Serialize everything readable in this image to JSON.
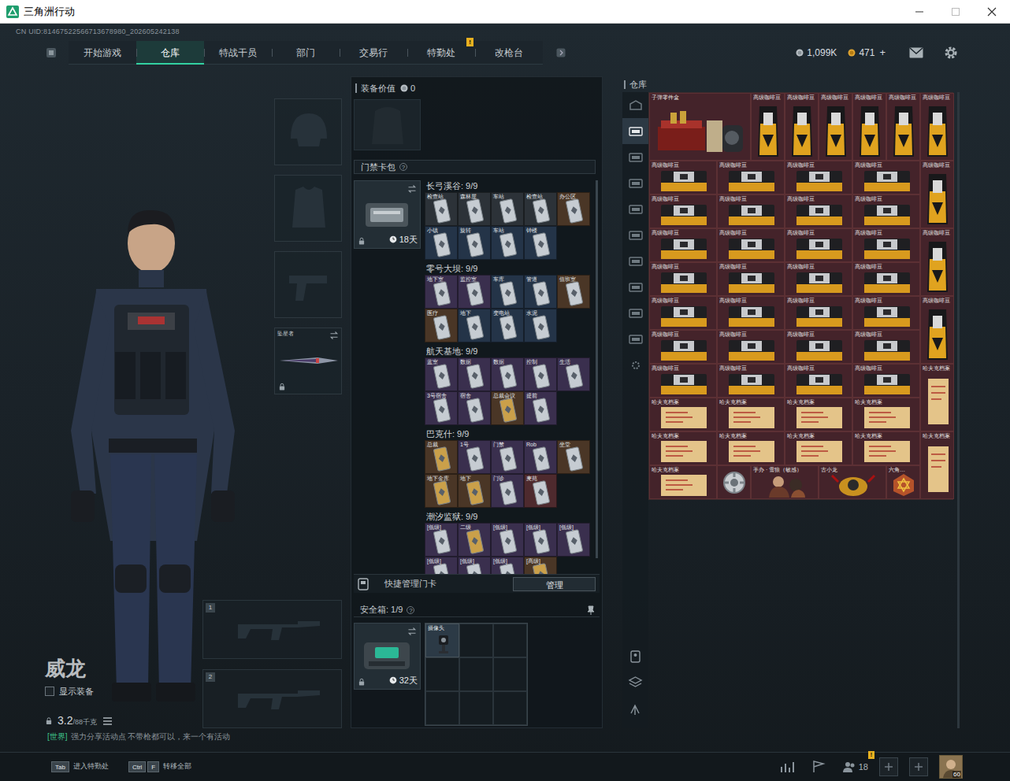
{
  "window": {
    "title": "三角洲行动"
  },
  "uid": "CN UID:81467522566713678980_202605242138",
  "nav": {
    "tabs": [
      {
        "label": "开始游戏",
        "selected": false
      },
      {
        "label": "仓库",
        "selected": true
      },
      {
        "label": "特战干员",
        "selected": false
      },
      {
        "label": "部门",
        "selected": false
      },
      {
        "label": "交易行",
        "selected": false
      },
      {
        "label": "特勤处",
        "selected": false,
        "badge": "!"
      },
      {
        "label": "改枪台",
        "selected": false
      }
    ]
  },
  "currency": {
    "coins": "1,099K",
    "premium": "471",
    "add": "+"
  },
  "operator": {
    "name": "威龙",
    "show_gear": {
      "label": "显示装备",
      "checked": false
    },
    "weight": "3.2",
    "weight_max": "/88千克"
  },
  "chat": {
    "channel": "[世界]",
    "text": "强力分享活动点 不带枪都可以，来一个有活动"
  },
  "gear_slots": [
    {
      "kind": "helmet"
    },
    {
      "kind": "armor"
    },
    {
      "kind": "pistol"
    },
    {
      "kind": "melee",
      "label": "坠星者",
      "locked": true
    }
  ],
  "weapon_slots": [
    {
      "number": "1"
    },
    {
      "number": "2"
    }
  ],
  "loadout": {
    "value_label": "装备价值",
    "value": "0",
    "keycard": {
      "title": "门禁卡包",
      "help": "?",
      "days": "18天",
      "maps": [
        {
          "title": "长弓溪谷: 9/9",
          "cards": [
            {
              "label": "检查站",
              "color": "#2c3238",
              "kind": "silver"
            },
            {
              "label": "森林屋",
              "color": "#2c3238",
              "kind": "silver"
            },
            {
              "label": "车站",
              "color": "#2c3238",
              "kind": "silver"
            },
            {
              "label": "检查站",
              "color": "#2c3238",
              "kind": "silver"
            },
            {
              "label": "办公区",
              "color": "#4a3626",
              "kind": "silver"
            },
            {
              "label": "小镇",
              "color": "#243448",
              "kind": "silver"
            },
            {
              "label": "旋转",
              "color": "#243448",
              "kind": "silver"
            },
            {
              "label": "车站",
              "color": "#243448",
              "kind": "silver"
            },
            {
              "label": "钟楼",
              "color": "#243448",
              "kind": "silver"
            }
          ]
        },
        {
          "title": "零号大坝: 9/9",
          "cards": [
            {
              "label": "地下室",
              "color": "#3a2f4e",
              "kind": "silver"
            },
            {
              "label": "监控室",
              "color": "#3a2f4e",
              "kind": "silver"
            },
            {
              "label": "车库",
              "color": "#243448",
              "kind": "silver"
            },
            {
              "label": "管道",
              "color": "#243448",
              "kind": "silver"
            },
            {
              "label": "值班室",
              "color": "#4a3626",
              "kind": "silver"
            },
            {
              "label": "医疗",
              "color": "#4a3626",
              "kind": "silver"
            },
            {
              "label": "地下",
              "color": "#243448",
              "kind": "silver"
            },
            {
              "label": "变电站",
              "color": "#243448",
              "kind": "silver"
            },
            {
              "label": "水泥",
              "color": "#243448",
              "kind": "silver"
            }
          ]
        },
        {
          "title": "航天基地: 9/9",
          "cards": [
            {
              "label": "蓝室",
              "color": "#3a2f4e",
              "kind": "silver"
            },
            {
              "label": "数据",
              "color": "#3a2f4e",
              "kind": "silver"
            },
            {
              "label": "数据",
              "color": "#3a2f4e",
              "kind": "silver"
            },
            {
              "label": "控制",
              "color": "#3a2f4e",
              "kind": "silver"
            },
            {
              "label": "生活",
              "color": "#3a2f4e",
              "kind": "silver"
            },
            {
              "label": "3号宿舍",
              "color": "#3a2f4e",
              "kind": "silver"
            },
            {
              "label": "宿舍",
              "color": "#3a2f4e",
              "kind": "silver"
            },
            {
              "label": "总裁会议",
              "color": "#4a3626",
              "kind": "gold"
            },
            {
              "label": "提前",
              "color": "#3a2f4e",
              "kind": "silver"
            }
          ]
        },
        {
          "title": "巴克什: 9/9",
          "cards": [
            {
              "label": "总裁",
              "color": "#4a3626",
              "kind": "gold"
            },
            {
              "label": "1号",
              "color": "#3a2f4e",
              "kind": "silver"
            },
            {
              "label": "门禁",
              "color": "#3a2f4e",
              "kind": "silver"
            },
            {
              "label": "Rob",
              "color": "#3a2f4e",
              "kind": "silver"
            },
            {
              "label": "坐堂",
              "color": "#4a3626",
              "kind": "silver"
            },
            {
              "label": "地下金库",
              "color": "#4a3626",
              "kind": "gold"
            },
            {
              "label": "地下",
              "color": "#4a3626",
              "kind": "gold"
            },
            {
              "label": "门诊",
              "color": "#3a2f4e",
              "kind": "silver"
            },
            {
              "label": "麦苑",
              "color": "#4e2a2e",
              "kind": "silver"
            }
          ]
        },
        {
          "title": "潮汐监狱: 9/9",
          "cards": [
            {
              "label": "[低级]",
              "color": "#3a2f4e",
              "kind": "silver"
            },
            {
              "label": "二级",
              "color": "#3a2f4e",
              "kind": "gold"
            },
            {
              "label": "[低级]",
              "color": "#3a2f4e",
              "kind": "silver"
            },
            {
              "label": "[低级]",
              "color": "#3a2f4e",
              "kind": "silver"
            },
            {
              "label": "[低级]",
              "color": "#3a2f4e",
              "kind": "silver"
            },
            {
              "label": "[低级]",
              "color": "#3a2f4e",
              "kind": "silver"
            },
            {
              "label": "[低级]",
              "color": "#3a2f4e",
              "kind": "silver"
            },
            {
              "label": "[低级]",
              "color": "#3a2f4e",
              "kind": "silver"
            },
            {
              "label": "[高级]",
              "color": "#4a3626",
              "kind": "gold"
            }
          ]
        }
      ]
    },
    "quick": {
      "label": "快捷管理门卡",
      "button": "管理"
    },
    "safebox": {
      "title": "安全箱: 1/9",
      "help": "?",
      "days": "32天",
      "items": [
        {
          "label": "摄像头"
        }
      ]
    }
  },
  "stash": {
    "title": "仓库",
    "tabs": [
      {
        "selected": false
      },
      {
        "selected": true
      },
      {
        "selected": false
      },
      {
        "selected": false
      },
      {
        "selected": false
      },
      {
        "selected": false
      },
      {
        "selected": false
      },
      {
        "selected": false
      },
      {
        "selected": false
      },
      {
        "selected": false
      },
      {
        "selected": false
      }
    ],
    "items": [
      {
        "label": "子弹零件盒",
        "kind": "ammo-box"
      },
      {
        "label": "高级咖啡豆",
        "kind": "coffee"
      },
      {
        "label": "高级咖啡豆",
        "kind": "coffee"
      },
      {
        "label": "高级咖啡豆",
        "kind": "coffee"
      },
      {
        "label": "高级咖啡豆",
        "kind": "coffee"
      },
      {
        "label": "高级咖啡豆",
        "kind": "coffee"
      },
      {
        "label": "高级咖啡豆",
        "kind": "coffee"
      },
      {
        "label": "高级咖啡豆",
        "kind": "coffee-gift"
      },
      {
        "label": "高级咖啡豆",
        "kind": "coffee-gift"
      },
      {
        "label": "高级咖啡豆",
        "kind": "coffee-gift"
      },
      {
        "label": "高级咖啡豆",
        "kind": "coffee-gift"
      },
      {
        "label": "高级咖啡豆",
        "kind": "coffee"
      },
      {
        "label": "高级咖啡豆",
        "kind": "coffee-gift"
      },
      {
        "label": "高级咖啡豆",
        "kind": "coffee-gift"
      },
      {
        "label": "高级咖啡豆",
        "kind": "coffee-gift"
      },
      {
        "label": "高级咖啡豆",
        "kind": "coffee-gift"
      },
      {
        "label": "高级咖啡豆",
        "kind": "coffee-gift"
      },
      {
        "label": "高级咖啡豆",
        "kind": "coffee-gift"
      },
      {
        "label": "高级咖啡豆",
        "kind": "coffee-gift"
      },
      {
        "label": "高级咖啡豆",
        "kind": "coffee-gift"
      },
      {
        "label": "高级咖啡豆",
        "kind": "coffee"
      },
      {
        "label": "高级咖啡豆",
        "kind": "coffee-gift"
      },
      {
        "label": "高级咖啡豆",
        "kind": "coffee-gift"
      },
      {
        "label": "高级咖啡豆",
        "kind": "coffee-gift"
      },
      {
        "label": "高级咖啡豆",
        "kind": "coffee-gift"
      },
      {
        "label": "高级咖啡豆",
        "kind": "coffee-gift"
      },
      {
        "label": "高级咖啡豆",
        "kind": "coffee-gift"
      },
      {
        "label": "高级咖啡豆",
        "kind": "coffee-gift"
      },
      {
        "label": "高级咖啡豆",
        "kind": "coffee-gift"
      },
      {
        "label": "高级咖啡豆",
        "kind": "coffee"
      },
      {
        "label": "高级咖啡豆",
        "kind": "coffee-gift"
      },
      {
        "label": "高级咖啡豆",
        "kind": "coffee-gift"
      },
      {
        "label": "高级咖啡豆",
        "kind": "coffee-gift"
      },
      {
        "label": "高级咖啡豆",
        "kind": "coffee-gift"
      },
      {
        "label": "高级咖啡豆",
        "kind": "coffee-gift"
      },
      {
        "label": "高级咖啡豆",
        "kind": "coffee-gift"
      },
      {
        "label": "高级咖啡豆",
        "kind": "coffee-gift"
      },
      {
        "label": "高级咖啡豆",
        "kind": "coffee-gift"
      },
      {
        "label": "哈夫克档案",
        "kind": "file-tall"
      },
      {
        "label": "哈夫克档案",
        "kind": "file-wide"
      },
      {
        "label": "哈夫克档案",
        "kind": "file-wide"
      },
      {
        "label": "哈夫克档案",
        "kind": "file-wide"
      },
      {
        "label": "哈夫克档案",
        "kind": "file-wide"
      },
      {
        "label": "哈夫克档案",
        "kind": "file-wide"
      },
      {
        "label": "哈夫克档案",
        "kind": "file-wide"
      },
      {
        "label": "哈夫克档案",
        "kind": "file-wide"
      },
      {
        "label": "哈夫克档案",
        "kind": "file-wide"
      },
      {
        "label": "哈夫克档案",
        "kind": "file-tall"
      },
      {
        "label": "哈夫克档案",
        "kind": "file-wide"
      },
      {
        "kind": "gear"
      },
      {
        "label": "手办 · 雪狼（敏感）",
        "kind": "figure"
      },
      {
        "label": "古小龙",
        "kind": "dragon"
      },
      {
        "label": "六角…",
        "kind": "hex"
      }
    ]
  },
  "hints": [
    {
      "keys": [
        "Tab"
      ],
      "label": "进入特勤处"
    },
    {
      "keys": [
        "Ctrl",
        "F"
      ],
      "label": "转移全部"
    }
  ],
  "bottom": {
    "friends": "18",
    "friends_badge": "!",
    "level": "60"
  }
}
